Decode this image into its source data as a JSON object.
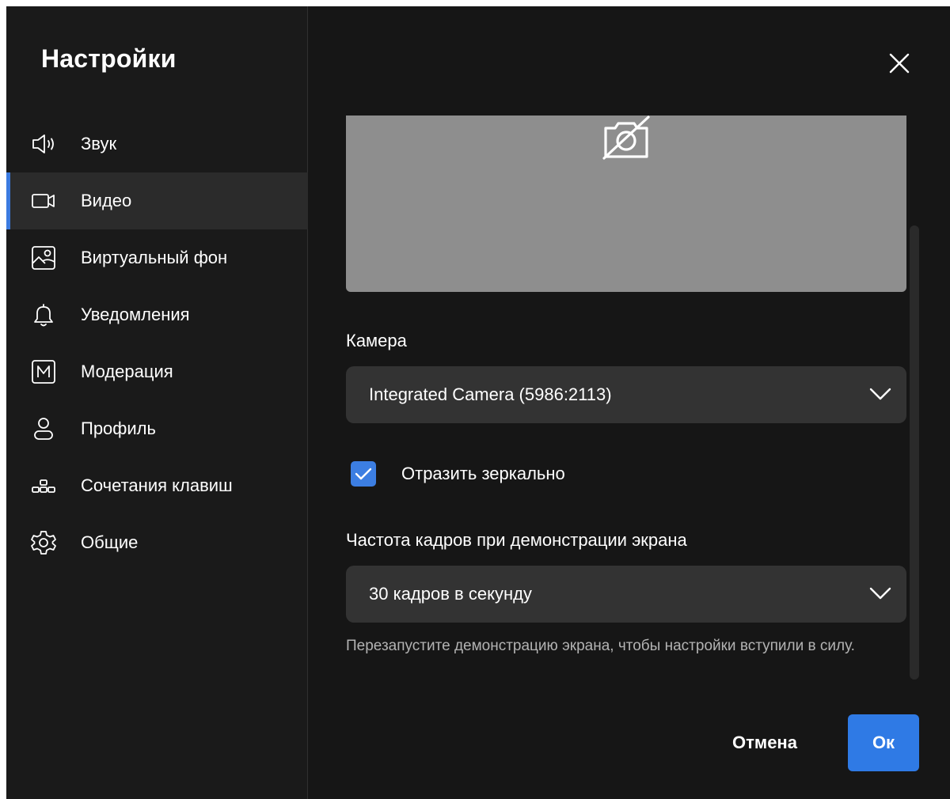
{
  "sidebar": {
    "title": "Настройки",
    "items": [
      {
        "label": "Звук",
        "icon": "speaker-icon",
        "active": false
      },
      {
        "label": "Видео",
        "icon": "video-camera-icon",
        "active": true
      },
      {
        "label": "Виртуальный фон",
        "icon": "image-person-icon",
        "active": false
      },
      {
        "label": "Уведомления",
        "icon": "bell-icon",
        "active": false
      },
      {
        "label": "Модерация",
        "icon": "moderation-m-icon",
        "active": false
      },
      {
        "label": "Профиль",
        "icon": "user-icon",
        "active": false
      },
      {
        "label": "Сочетания клавиш",
        "icon": "keyboard-shortcuts-icon",
        "active": false
      },
      {
        "label": "Общие",
        "icon": "gear-icon",
        "active": false
      }
    ]
  },
  "main": {
    "close_icon": "close-icon",
    "preview_icon": "camera-off-icon",
    "camera": {
      "label": "Камера",
      "value": "Integrated Camera (5986:2113)"
    },
    "mirror": {
      "label": "Отразить зеркально",
      "checked": true
    },
    "fps": {
      "label": "Частота кадров при демонстрации экрана",
      "value": "30 кадров в секунду",
      "hint": "Перезапустите демонстрацию экрана, чтобы настройки вступили в силу."
    }
  },
  "footer": {
    "cancel_label": "Отмена",
    "ok_label": "Ок"
  },
  "colors": {
    "accent": "#2f7ae5",
    "background": "#161616",
    "sidebar_active": "#2b2b2b",
    "field_bg": "#333333",
    "preview_bg": "#8e8e8e"
  }
}
